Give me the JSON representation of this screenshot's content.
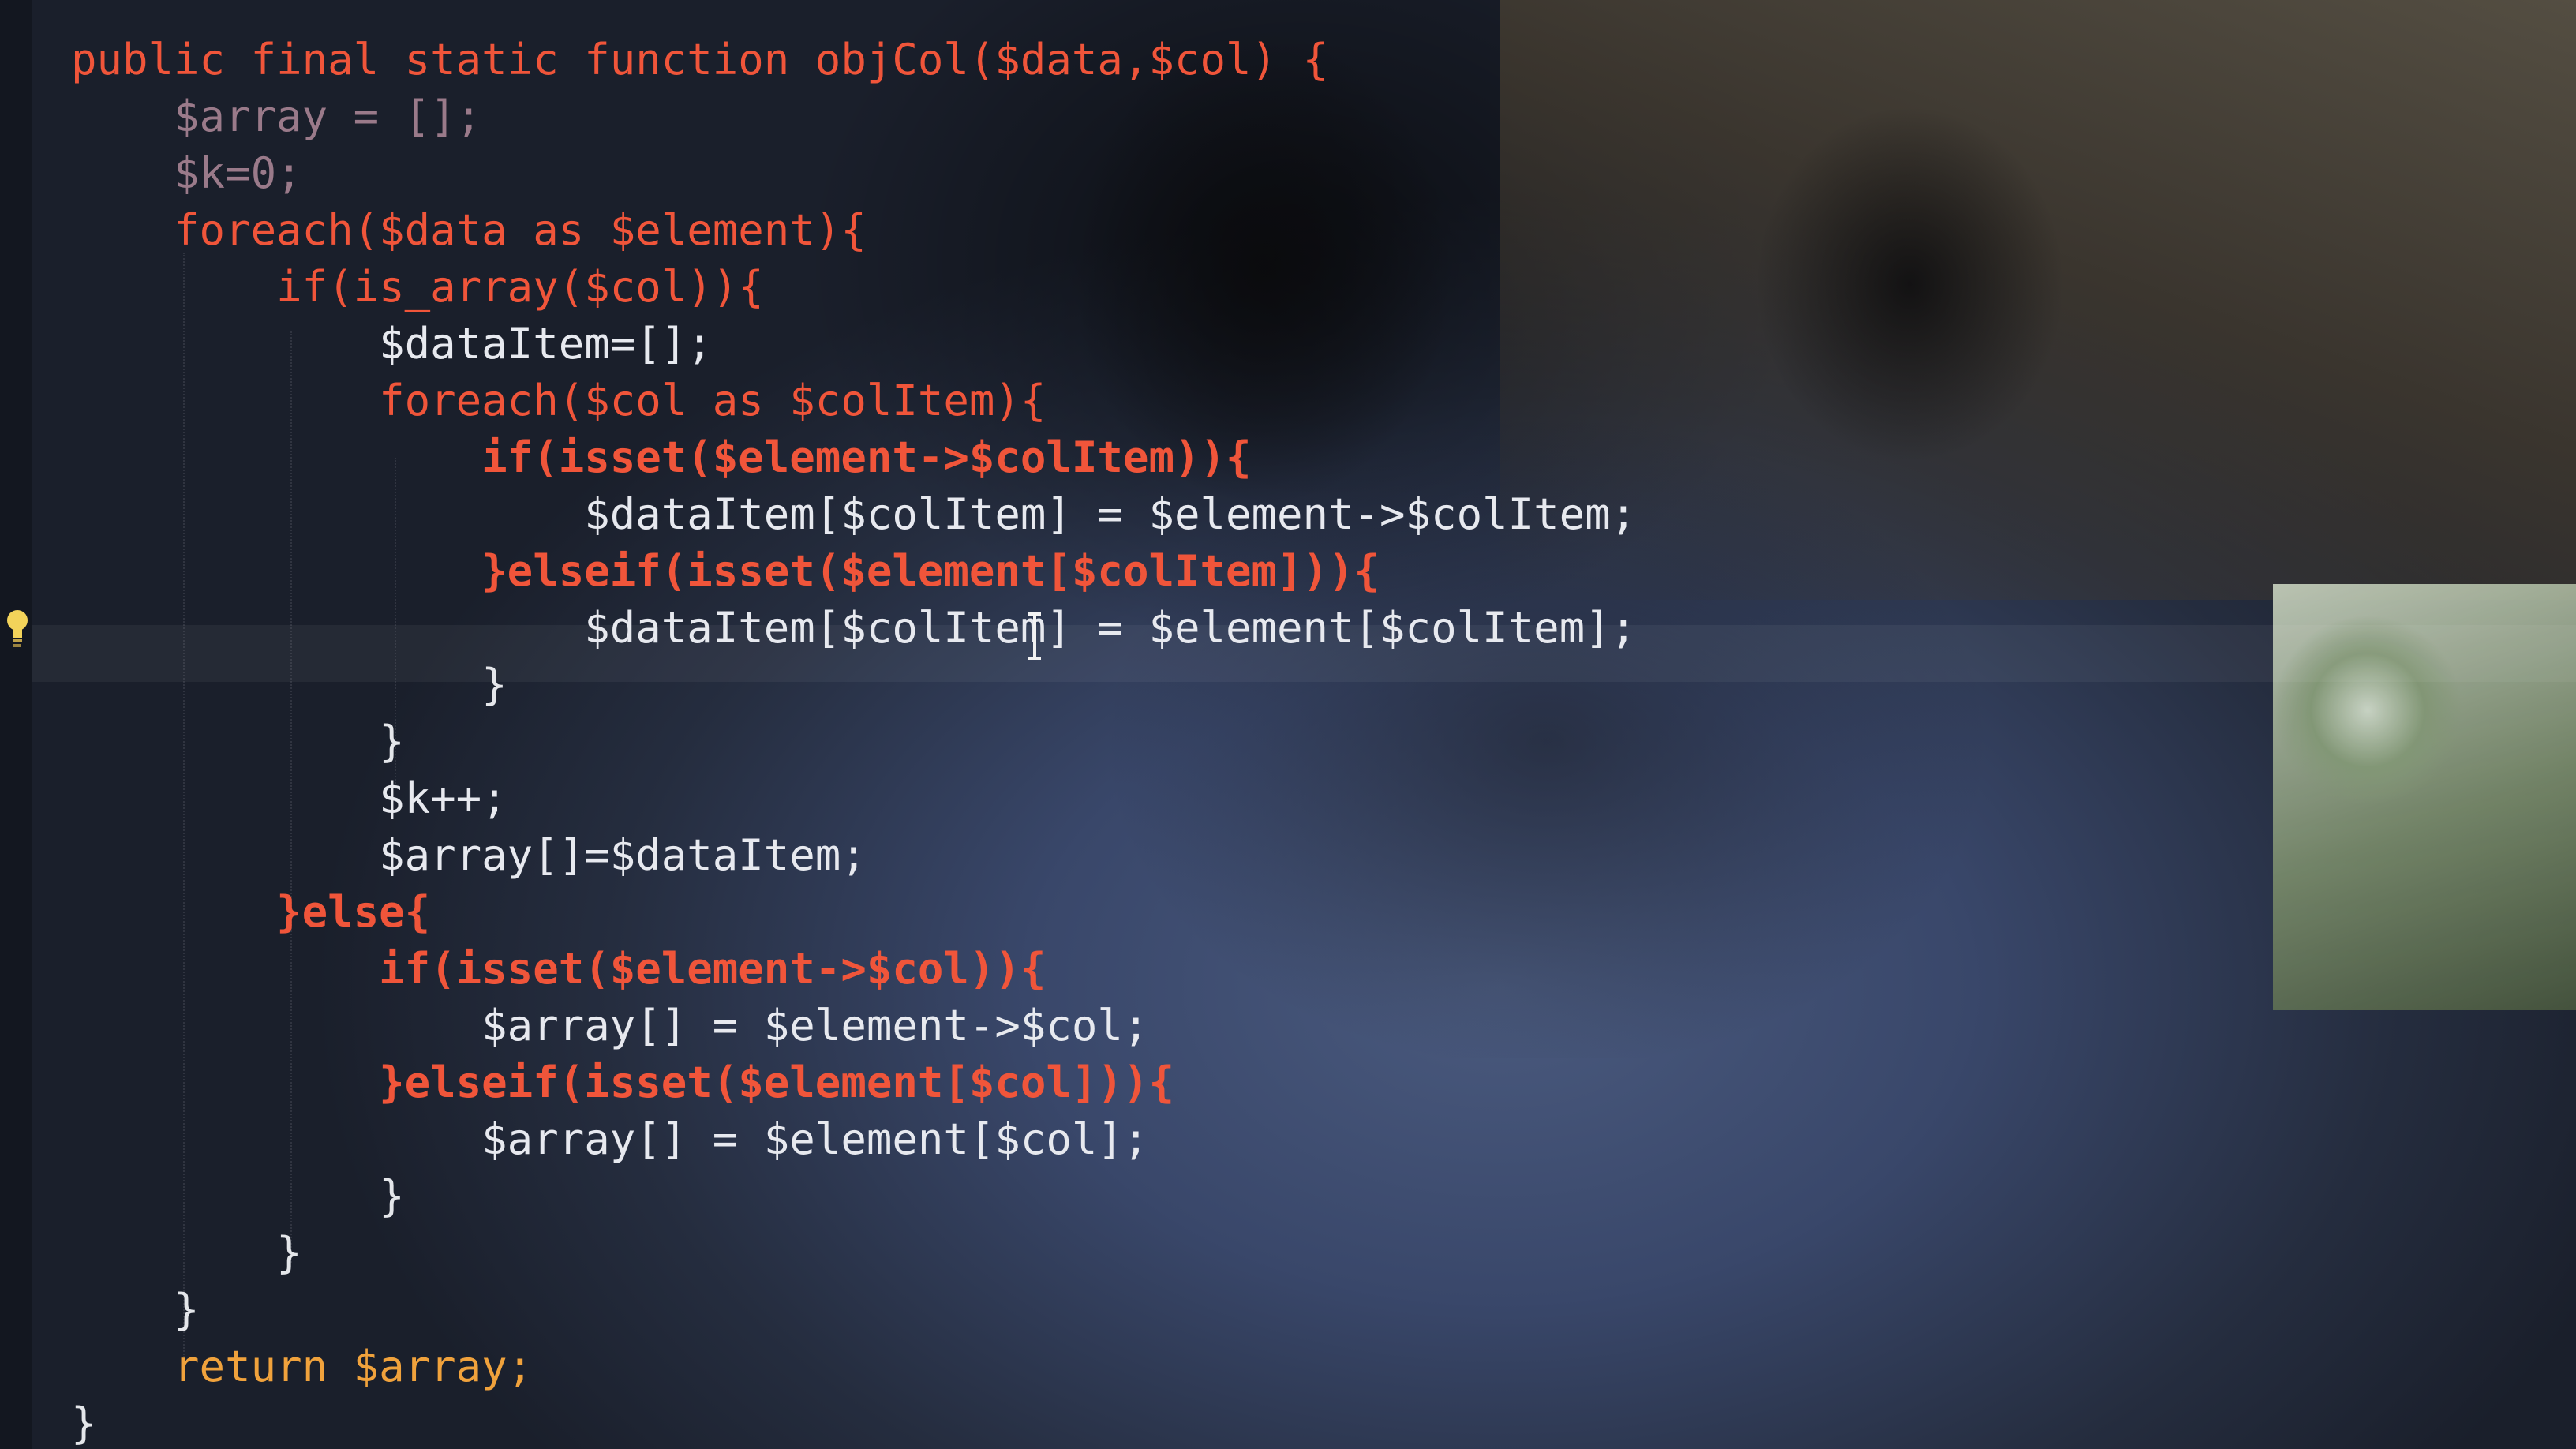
{
  "editor": {
    "theme_colors": {
      "keyword": "#f0553a",
      "function_name": "#f0a23c",
      "variable": "#e7e9ef",
      "background": "#1b2028"
    },
    "gutter_icons": [
      "lightbulb-icon"
    ],
    "lines": [
      "public final static function objCol($data,$col) {",
      "    $array = [];",
      "    $k=0;",
      "    foreach($data as $element){",
      "        if(is_array($col)){",
      "            $dataItem=[];",
      "            foreach($col as $colItem){",
      "                if(isset($element->$colItem)){",
      "                    $dataItem[$colItem] = $element->$colItem;",
      "                }elseif(isset($element[$colItem])){",
      "                    $dataItem[$colItem] = $element[$colItem];",
      "                }",
      "            }",
      "            $k++;",
      "            $array[]=$dataItem;",
      "        }else{",
      "            if(isset($element->$col)){",
      "                $array[] = $element->$col;",
      "            }elseif(isset($element[$col])){",
      "                $array[] = $element[$col];",
      "            }",
      "        }",
      "    }",
      "    return $array;",
      "}"
    ]
  }
}
